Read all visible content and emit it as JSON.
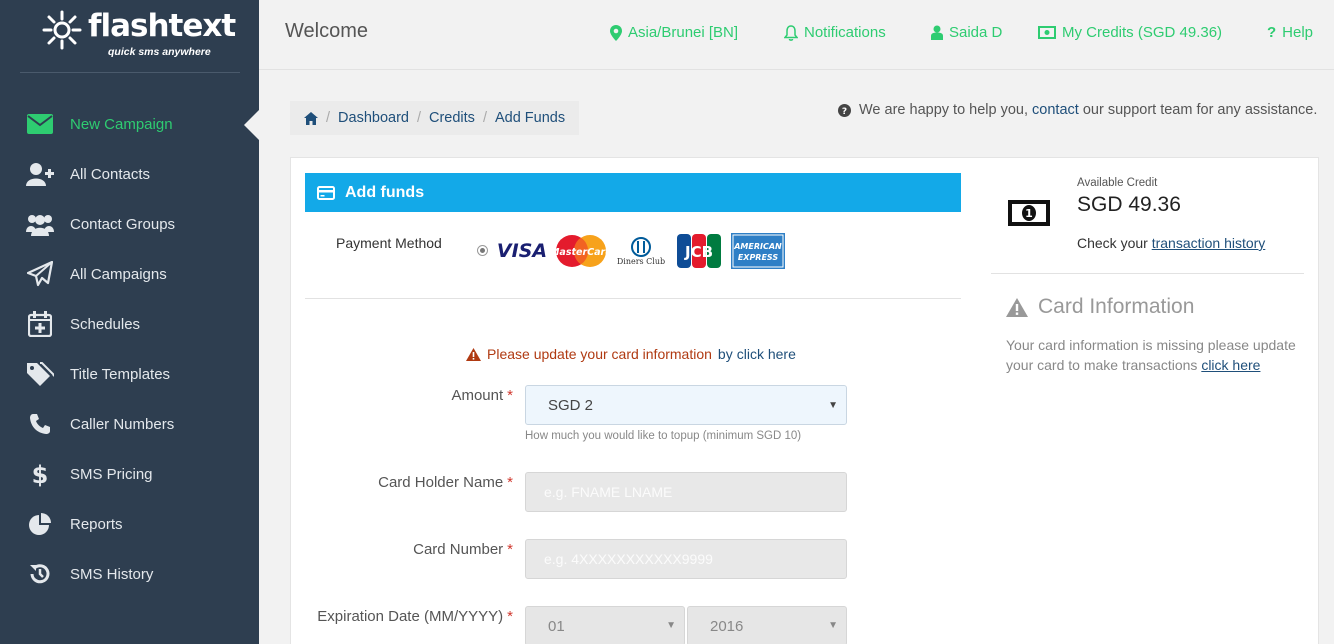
{
  "brand": {
    "name": "flashtext",
    "tagline": "quick sms anywhere"
  },
  "colors": {
    "sidebar": "#2e3e50",
    "accent": "#2ecc71",
    "primary_bar": "#13a9e8",
    "link": "#1f4f7a",
    "warning": "#b03a12"
  },
  "sidebar": {
    "items": [
      {
        "label": "New Campaign",
        "icon": "envelope-icon",
        "active": true
      },
      {
        "label": "All Contacts",
        "icon": "user-plus-icon"
      },
      {
        "label": "Contact Groups",
        "icon": "users-icon"
      },
      {
        "label": "All Campaigns",
        "icon": "paper-plane-icon"
      },
      {
        "label": "Schedules",
        "icon": "calendar-plus-icon"
      },
      {
        "label": "Title Templates",
        "icon": "tags-icon"
      },
      {
        "label": "Caller Numbers",
        "icon": "phone-icon"
      },
      {
        "label": "SMS Pricing",
        "icon": "dollar-icon"
      },
      {
        "label": "Reports",
        "icon": "pie-chart-icon"
      },
      {
        "label": "SMS History",
        "icon": "history-icon"
      }
    ]
  },
  "header": {
    "title": "Welcome",
    "timezone": "Asia/Brunei [BN]",
    "notifications": "Notifications",
    "user": "Saida D",
    "credits": "My Credits (SGD 49.36)",
    "help": "Help"
  },
  "breadcrumb": {
    "items": [
      "Dashboard",
      "Credits",
      "Add Funds"
    ]
  },
  "support": {
    "prefix": "We are happy to help you,",
    "link": "contact",
    "suffix": "our support team for any assistance."
  },
  "form": {
    "title": "Add funds",
    "payment_method_label": "Payment Method",
    "card_brands": [
      "VISA",
      "MasterCard",
      "Diners Club",
      "JCB",
      "American Express"
    ],
    "warning": {
      "message": "Please update your card information",
      "by": "by",
      "link": "click here"
    },
    "amount": {
      "label": "Amount",
      "value": "SGD 2",
      "hint": "How much you would like to topup (minimum SGD 10)"
    },
    "card_holder": {
      "label": "Card Holder Name",
      "placeholder": "e.g. FNAME LNAME"
    },
    "card_number": {
      "label": "Card Number",
      "placeholder": "e.g. 4XXXXXXXXXXX9999"
    },
    "expiration": {
      "label": "Expiration Date (MM/YYYY)",
      "month": "01",
      "year": "2016"
    },
    "required_mark": "*"
  },
  "credit_panel": {
    "available_label": "Available Credit",
    "available_value": "SGD 49.36",
    "txn_prefix": "Check your",
    "txn_link": "transaction history"
  },
  "card_info": {
    "title": "Card Information",
    "text": "Your card information is missing please update your card to make transactions",
    "link": "click here"
  }
}
